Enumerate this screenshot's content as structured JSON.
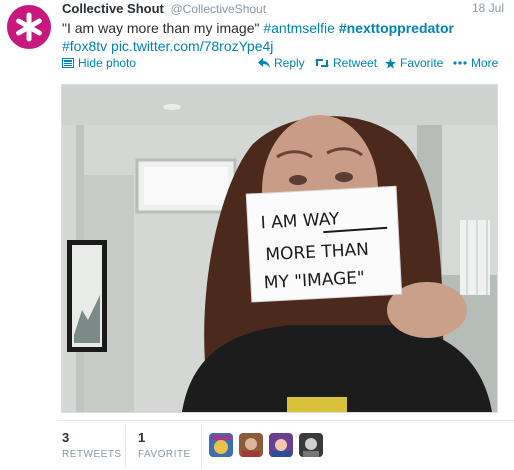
{
  "tweet": {
    "author_name": "Collective Shout",
    "author_handle": "@CollectiveShout",
    "time": "18 Jul",
    "text_plain": "\"I am way more than my image\"",
    "hashtag1": "#antmselfie",
    "hashtag2": "#nexttoppredator",
    "hashtag3": "#fox8tv",
    "link": "pic.twitter.com/78rozYpe4j",
    "colors": {
      "link": "#0084b4",
      "avatar_bg": "#c8177d"
    }
  },
  "actions": {
    "hide_photo": "Hide photo",
    "reply": "Reply",
    "retweet": "Retweet",
    "favorite": "Favorite",
    "more": "More"
  },
  "photo": {
    "sign_line1": "I AM WAY",
    "sign_line2": "MORE THAN",
    "sign_line3": "MY \"IMAGE\""
  },
  "stats": {
    "retweets_count": "3",
    "retweets_label": "RETWEETS",
    "favorites_count": "1",
    "favorites_label": "FAVORITE"
  },
  "icons": [
    "asterisk-logo-icon",
    "photo-icon",
    "reply-icon",
    "retweet-icon",
    "star-icon",
    "more-dots-icon"
  ]
}
